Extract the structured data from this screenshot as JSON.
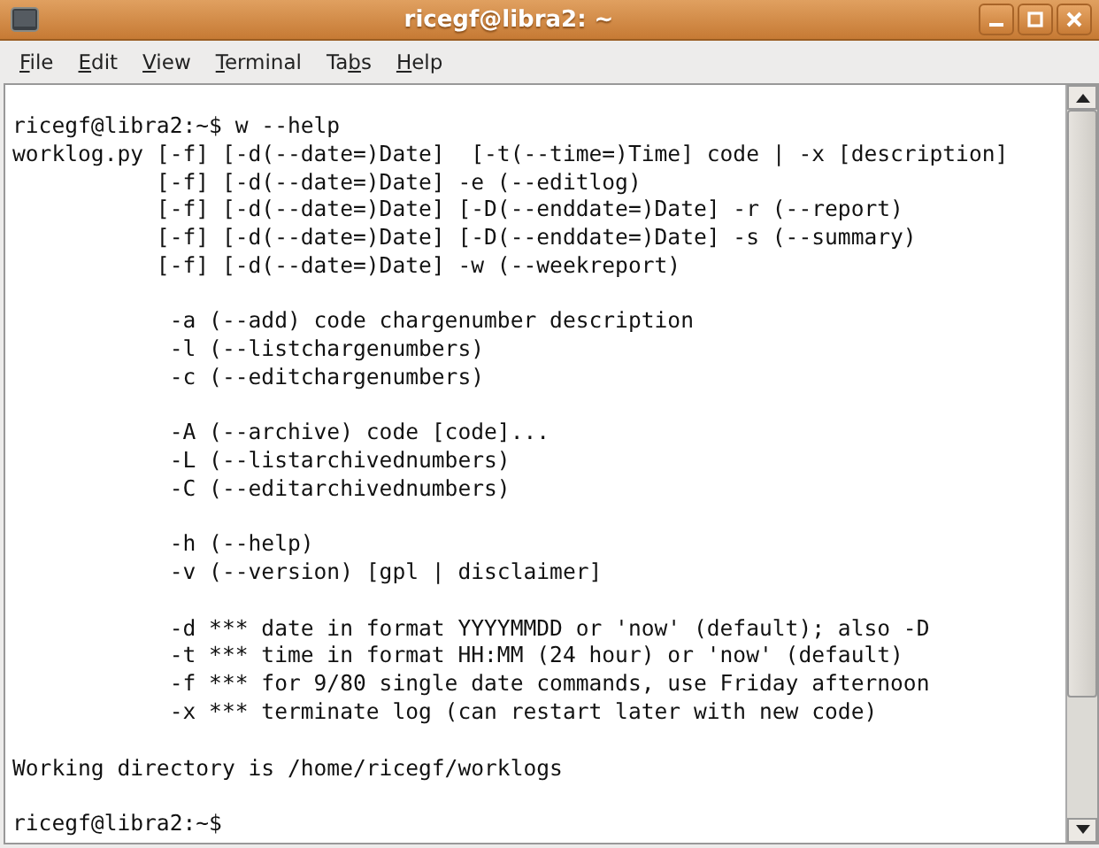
{
  "window": {
    "title": "ricegf@libra2: ~"
  },
  "menu": [
    {
      "key": "F",
      "after": "ile"
    },
    {
      "key": "E",
      "after": "dit"
    },
    {
      "key": "V",
      "after": "iew"
    },
    {
      "key": "T",
      "after": "erminal"
    },
    {
      "before": "Ta",
      "key": "b",
      "after": "s"
    },
    {
      "key": "H",
      "after": "elp"
    }
  ],
  "terminal": {
    "blocks": [
      [
        "ricegf@libra2:~$ w --help",
        "worklog.py [-f] [-d(--date=)Date]  [-t(--time=)Time] code | -x [description]",
        "           [-f] [-d(--date=)Date] -e (--editlog)",
        "           [-f] [-d(--date=)Date] [-D(--enddate=)Date] -r (--report)",
        "           [-f] [-d(--date=)Date] [-D(--enddate=)Date] -s (--summary)",
        "           [-f] [-d(--date=)Date] -w (--weekreport)"
      ],
      [
        "            -a (--add) code chargenumber description",
        "            -l (--listchargenumbers)",
        "            -c (--editchargenumbers)"
      ],
      [
        "            -A (--archive) code [code]...",
        "            -L (--listarchivednumbers)",
        "            -C (--editarchivednumbers)"
      ],
      [
        "            -h (--help)",
        "            -v (--version) [gpl | disclaimer]"
      ],
      [
        "            -d *** date in format YYYYMMDD or 'now' (default); also -D",
        "            -t *** time in format HH:MM (24 hour) or 'now' (default)",
        "            -f *** for 9/80 single date commands, use Friday afternoon",
        "            -x *** terminate log (can restart later with new code)"
      ],
      [
        "Working directory is /home/ricegf/worklogs"
      ],
      [
        "ricegf@libra2:~$"
      ]
    ]
  }
}
